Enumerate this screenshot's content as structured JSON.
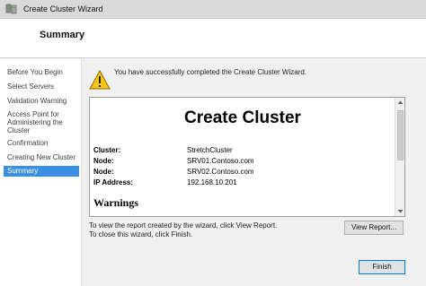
{
  "window": {
    "title": "Create Cluster Wizard"
  },
  "header": {
    "title": "Summary"
  },
  "sidebar": {
    "items": [
      {
        "label": "Before You Begin"
      },
      {
        "label": "Select Servers"
      },
      {
        "label": "Validation Warning"
      },
      {
        "label": "Access Point for Administering the Cluster"
      },
      {
        "label": "Confirmation"
      },
      {
        "label": "Creating New Cluster"
      },
      {
        "label": "Summary"
      }
    ],
    "active_index": 6
  },
  "main": {
    "success_message": "You have successfully completed the Create Cluster Wizard.",
    "report": {
      "title": "Create Cluster",
      "rows": [
        {
          "key": "Cluster:",
          "value": "StretchCluster"
        },
        {
          "key": "Node:",
          "value": "SRV01.Contoso.com"
        },
        {
          "key": "Node:",
          "value": "SRV02.Contoso.com"
        },
        {
          "key": "IP Address:",
          "value": "192.168.10.201"
        }
      ],
      "warnings_heading": "Warnings"
    },
    "info_line_1": "To view the report created by the wizard, click View Report.",
    "info_line_2": "To close this wizard, click Finish."
  },
  "buttons": {
    "view_report": "View Report...",
    "finish": "Finish"
  },
  "colors": {
    "active_item_bg": "#3b8fe0",
    "warning_yellow": "#f5c518"
  }
}
